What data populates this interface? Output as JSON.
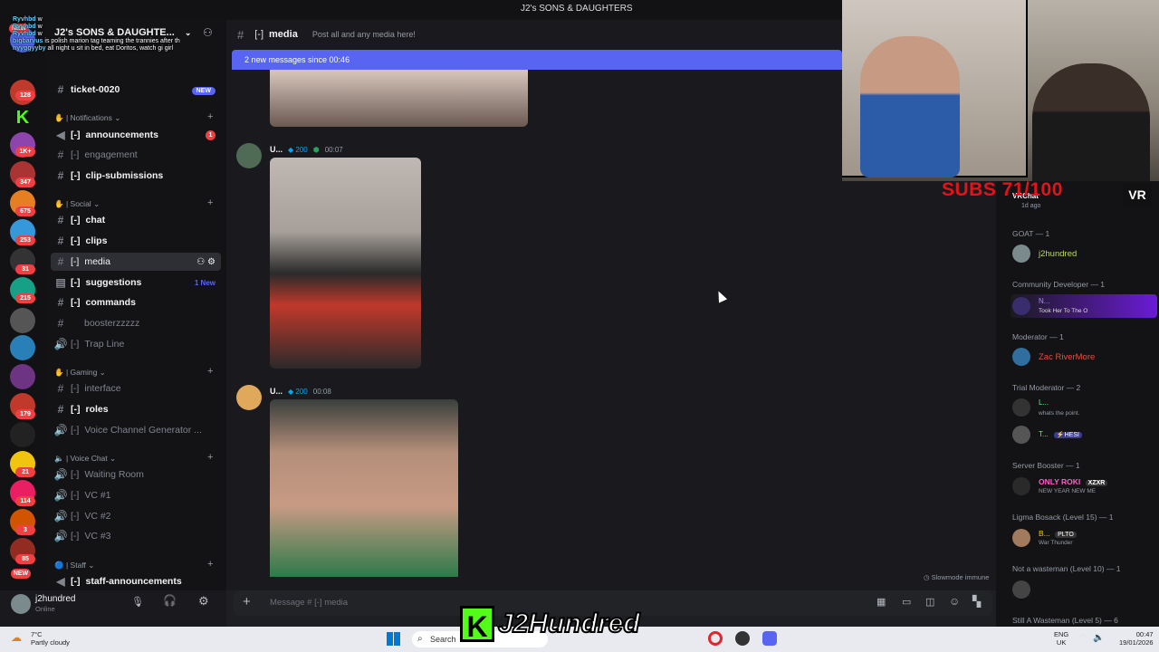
{
  "window_title": "J2's SONS & DAUGHTERS",
  "server": {
    "name": "J2's SONS & DAUGHTE..."
  },
  "rail_badges": [
    "NEW",
    "128",
    "1K+",
    "347",
    "675",
    "253",
    "31",
    "215",
    "179",
    "21",
    "114",
    "3",
    "85",
    "NEW"
  ],
  "channels": [
    {
      "id": "ticket",
      "label": "ticket-0020",
      "prefix": "",
      "badge": "NEW",
      "unread": true
    },
    {
      "id": "announcements",
      "label": "announcements",
      "prefix": "[-]",
      "count": "1",
      "unread": true
    },
    {
      "id": "engagement",
      "label": "engagement",
      "prefix": "[-]",
      "unread": false
    },
    {
      "id": "clip-submissions",
      "label": "clip-submissions",
      "prefix": "[-]",
      "unread": true
    },
    {
      "id": "chat",
      "label": "chat",
      "prefix": "[-]",
      "unread": true
    },
    {
      "id": "clips",
      "label": "clips",
      "prefix": "[-]",
      "unread": true
    },
    {
      "id": "media",
      "label": "media",
      "prefix": "[-]",
      "active": true
    },
    {
      "id": "suggestions",
      "label": "suggestions",
      "prefix": "[-]",
      "badge": "1 New",
      "unread": true
    },
    {
      "id": "commands",
      "label": "commands",
      "prefix": "[-]",
      "unread": true
    },
    {
      "id": "boosterzzzzz",
      "label": "boosterzzzzz",
      "prefix": "",
      "unread": false
    },
    {
      "id": "trap-line",
      "label": "Trap Line",
      "prefix": "[-]",
      "unread": false
    },
    {
      "id": "interface",
      "label": "interface",
      "prefix": "[-]",
      "unread": false
    },
    {
      "id": "roles",
      "label": "roles",
      "prefix": "[-]",
      "unread": true
    },
    {
      "id": "voice-gen",
      "label": "Voice Channel Generator ...",
      "prefix": "[-]",
      "unread": false
    },
    {
      "id": "waiting-room",
      "label": "Waiting Room",
      "prefix": "[-]",
      "unread": false
    },
    {
      "id": "vc1",
      "label": "VC #1",
      "prefix": "[-]",
      "unread": false
    },
    {
      "id": "vc2",
      "label": "VC #2",
      "prefix": "[-]",
      "unread": false
    },
    {
      "id": "vc3",
      "label": "VC #3",
      "prefix": "[-]",
      "unread": false
    },
    {
      "id": "staff-ann",
      "label": "staff-announcements",
      "prefix": "[-]",
      "unread": true
    }
  ],
  "categories": {
    "notifications": "| Notifications",
    "social": "| Social",
    "gaming": "| Gaming",
    "voice": "| Voice Chat",
    "staff": "| Staff"
  },
  "user": {
    "name": "j2hundred",
    "status": "Online"
  },
  "chat": {
    "channel_prefix": "[-]",
    "channel_name": "media",
    "topic": "Post all and any media here!",
    "new_messages_banner": "2 new messages since 00:46",
    "messages": [
      {
        "author": "U...",
        "badge": "200",
        "time": "00:07"
      },
      {
        "author": "U...",
        "badge": "200",
        "time": "00:08"
      }
    ],
    "composer_placeholder": "Message # [-] media",
    "slowmode": "Slowmode immune"
  },
  "members": {
    "groups": [
      {
        "heading": "GOAT — 1",
        "names": [
          "j2hundred"
        ]
      },
      {
        "heading": "Community Developer — 1",
        "names": [
          "N..."
        ],
        "sub": "Took Her To The O"
      },
      {
        "heading": "Moderator — 1",
        "names": [
          "Zac RiverMore"
        ]
      },
      {
        "heading": "Trial Moderator — 2",
        "names": [
          "L...",
          "T..."
        ],
        "sub": "whats the point.",
        "tag": "HESI"
      },
      {
        "heading": "Server Booster — 1",
        "names": [
          "ONLY ROKI"
        ],
        "tag": "XZXR",
        "sub": "NEW YEAR NEW ME"
      },
      {
        "heading": "Ligma Bosack (Level 15) — 1",
        "names": [
          "B..."
        ],
        "tag": "PLTO",
        "sub": "War Thunder"
      },
      {
        "heading": "Not a wasteman (Level 10) — 1",
        "names": []
      },
      {
        "heading": "Still A Wasteman (Level 5) — 6",
        "names": []
      }
    ],
    "vrchat": {
      "label": "VRChat",
      "sub": "1d ago"
    }
  },
  "stream": {
    "subs": "SUBS 71/100",
    "vr_label": "VR",
    "logo_text": "J2Hundred",
    "overlay_lines": [
      {
        "user": "Ryvhbd",
        "text": "w"
      },
      {
        "user": "Ryvhbd",
        "text": "w"
      },
      {
        "user": "Ryvhbd",
        "text": "w"
      },
      {
        "user": "bigbarvus",
        "text": "is polish marion tag teaming the trannies after th"
      },
      {
        "user": "hyyggyyby",
        "text": "all night u sit in bed, eat Doritos, watch gi girl"
      }
    ],
    "kick_letter": "K"
  },
  "taskbar": {
    "weather_temp": "7°C",
    "weather_desc": "Partly cloudy",
    "search": "Search",
    "lang_top": "ENG",
    "lang_bottom": "UK",
    "time": "00:47",
    "date": "19/01/2026"
  },
  "colors": {
    "accent": "#5865f2",
    "danger": "#f23f43",
    "kick_green": "#53fc18",
    "subs_red": "#e4131a"
  }
}
